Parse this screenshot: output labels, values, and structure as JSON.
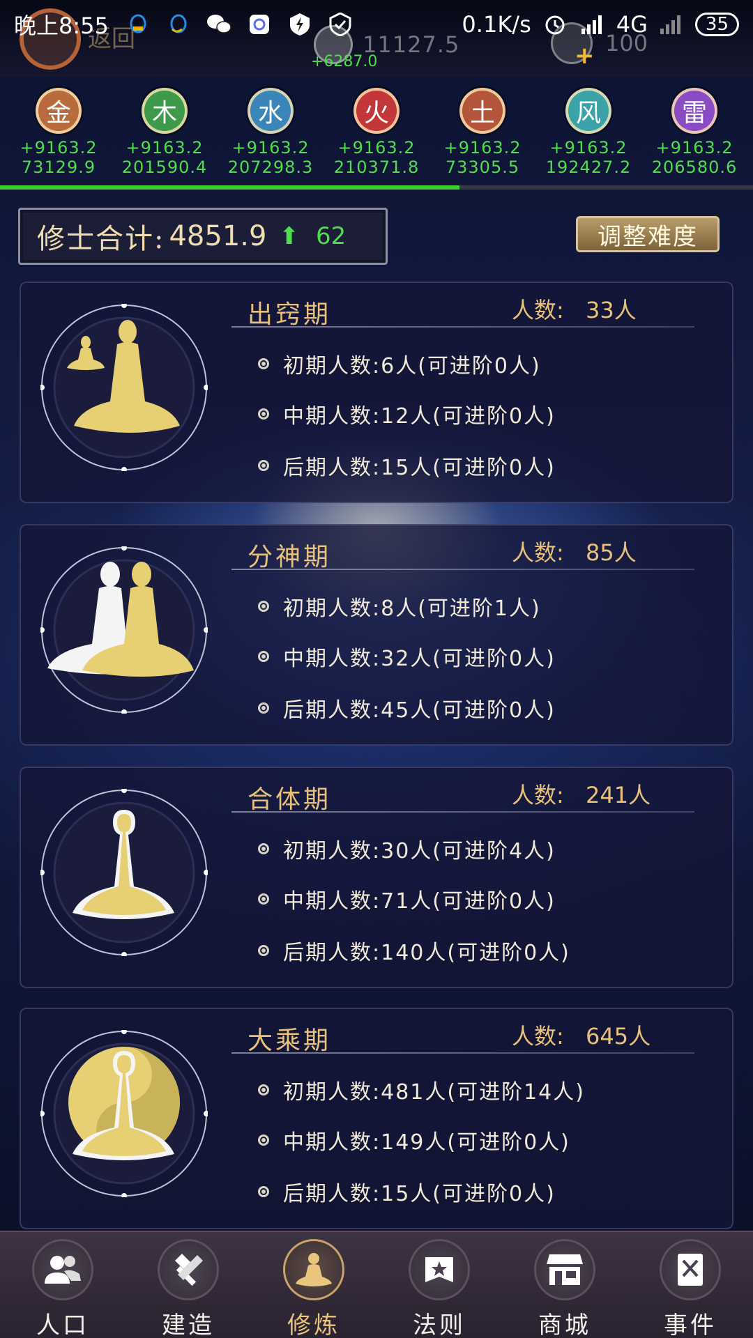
{
  "status_bar": {
    "time": "晚上8:55",
    "network_speed": "0.1K/s",
    "network_type": "4G",
    "battery": "35"
  },
  "header": {
    "back_label": "返回",
    "resource_value": "11127.5",
    "resource_gain": "+6287.0",
    "gem_value": "100"
  },
  "elements": [
    {
      "char": "金",
      "gain": "+9163.2",
      "total": "73129.9",
      "color": "#b86b3c"
    },
    {
      "char": "木",
      "gain": "+9163.2",
      "total": "201590.4",
      "color": "#3c9a4a"
    },
    {
      "char": "水",
      "gain": "+9163.2",
      "total": "207298.3",
      "color": "#3b86b8"
    },
    {
      "char": "火",
      "gain": "+9163.2",
      "total": "210371.8",
      "color": "#c2383a"
    },
    {
      "char": "土",
      "gain": "+9163.2",
      "total": "73305.5",
      "color": "#b2553a"
    },
    {
      "char": "风",
      "gain": "+9163.2",
      "total": "192427.2",
      "color": "#3ba3a8"
    },
    {
      "char": "雷",
      "gain": "+9163.2",
      "total": "206580.6",
      "color": "#8a4cc4"
    }
  ],
  "progress": 0.61,
  "summary": {
    "label": "修士合计:",
    "value": "4851.9",
    "delta": "62",
    "adjust_button": "调整难度"
  },
  "realms": [
    {
      "name": "出窍期",
      "count_label": "人数:",
      "count": "33人",
      "stages": [
        "初期人数:6人(可进阶0人)",
        "中期人数:12人(可进阶0人)",
        "后期人数:15人(可进阶0人)"
      ]
    },
    {
      "name": "分神期",
      "count_label": "人数:",
      "count": "85人",
      "stages": [
        "初期人数:8人(可进阶1人)",
        "中期人数:32人(可进阶0人)",
        "后期人数:45人(可进阶0人)"
      ]
    },
    {
      "name": "合体期",
      "count_label": "人数:",
      "count": "241人",
      "stages": [
        "初期人数:30人(可进阶4人)",
        "中期人数:71人(可进阶0人)",
        "后期人数:140人(可进阶0人)"
      ]
    },
    {
      "name": "大乘期",
      "count_label": "人数:",
      "count": "645人",
      "stages": [
        "初期人数:481人(可进阶14人)",
        "中期人数:149人(可进阶0人)",
        "后期人数:15人(可进阶0人)"
      ]
    }
  ],
  "nav": [
    {
      "label": "人口",
      "icon": "population-icon"
    },
    {
      "label": "建造",
      "icon": "build-icon"
    },
    {
      "label": "修炼",
      "icon": "cultivate-icon",
      "active": true
    },
    {
      "label": "法则",
      "icon": "law-icon"
    },
    {
      "label": "商城",
      "icon": "shop-icon"
    },
    {
      "label": "事件",
      "icon": "event-icon"
    }
  ]
}
